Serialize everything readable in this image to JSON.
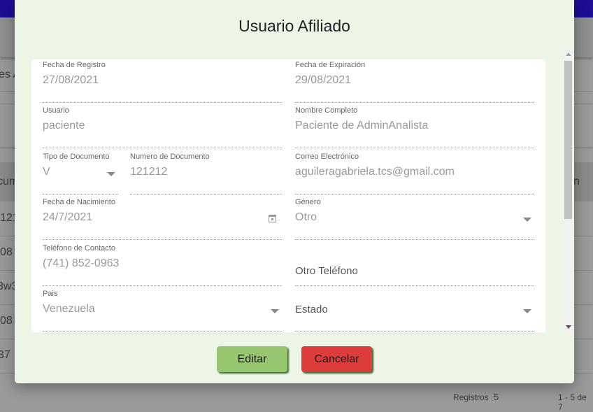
{
  "background": {
    "header_fragment": "es A",
    "column_fragment": "cum",
    "column_fragment_right": "n",
    "rows": [
      "121",
      "08",
      "3w3",
      "08",
      "37"
    ],
    "pagination_label": "Registros",
    "pagination_value": "5",
    "pagination_range": "1 - 5 de 7"
  },
  "modal": {
    "title": "Usuario Afiliado",
    "fields": {
      "fecha_registro": {
        "label": "Fecha de Registro",
        "value": "27/08/2021"
      },
      "fecha_expiracion": {
        "label": "Fecha de Expiración",
        "value": "29/08/2021"
      },
      "usuario": {
        "label": "Usuario",
        "value": "paciente"
      },
      "nombre": {
        "label": "Nombre Completo",
        "value": "Paciente de AdminAnalista"
      },
      "tipo_doc": {
        "label": "Tipo de Documento",
        "value": "V"
      },
      "num_doc": {
        "label": "Numero de Documento",
        "value": "121212"
      },
      "correo": {
        "label": "Correo Electrónico",
        "value": "aguileragabriela.tcs@gmail.com"
      },
      "fecha_nac": {
        "label": "Fecha de Nacimiento",
        "value": "24/7/2021"
      },
      "genero": {
        "label": "Género",
        "value": "Otro"
      },
      "telefono": {
        "label": "Teléfono de Contacto",
        "value": "(741) 852-0963"
      },
      "otro_telefono": {
        "placeholder": "Otro Teléfono"
      },
      "pais": {
        "label": "Pais",
        "value": "Venezuela"
      },
      "estado": {
        "placeholder": "Estado"
      }
    },
    "buttons": {
      "edit": "Editar",
      "cancel": "Cancelar"
    },
    "colors": {
      "edit": "#98c56f",
      "cancel": "#dc3c3c",
      "modal_bg": "#edf5e7"
    }
  }
}
